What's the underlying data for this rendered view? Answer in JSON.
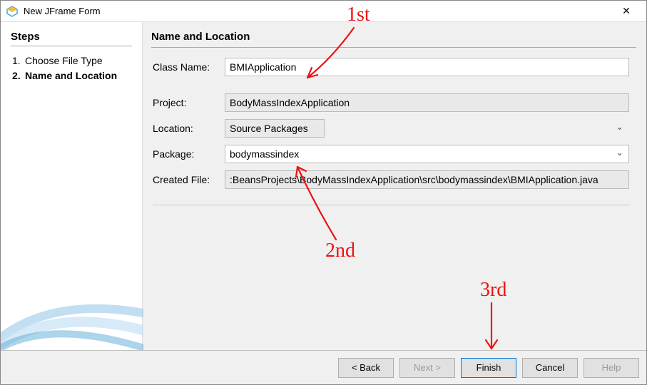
{
  "window": {
    "title": "New JFrame Form"
  },
  "sidebar": {
    "heading": "Steps",
    "steps": [
      {
        "num": "1.",
        "label": "Choose File Type",
        "current": false
      },
      {
        "num": "2.",
        "label": "Name and Location",
        "current": true
      }
    ]
  },
  "content": {
    "heading": "Name and Location",
    "className": {
      "label": "Class Name:",
      "value": "BMIApplication"
    },
    "project": {
      "label": "Project:",
      "value": "BodyMassIndexApplication"
    },
    "location": {
      "label": "Location:",
      "value": "Source Packages"
    },
    "package": {
      "label": "Package:",
      "value": "bodymassindex"
    },
    "createdFile": {
      "label": "Created File:",
      "value": ":BeansProjects\\BodyMassIndexApplication\\src\\bodymassindex\\BMIApplication.java"
    }
  },
  "footer": {
    "back": "< Back",
    "next": "Next >",
    "finish": "Finish",
    "cancel": "Cancel",
    "help": "Help"
  },
  "annotations": {
    "first": "1st",
    "second": "2nd",
    "third": "3rd"
  }
}
